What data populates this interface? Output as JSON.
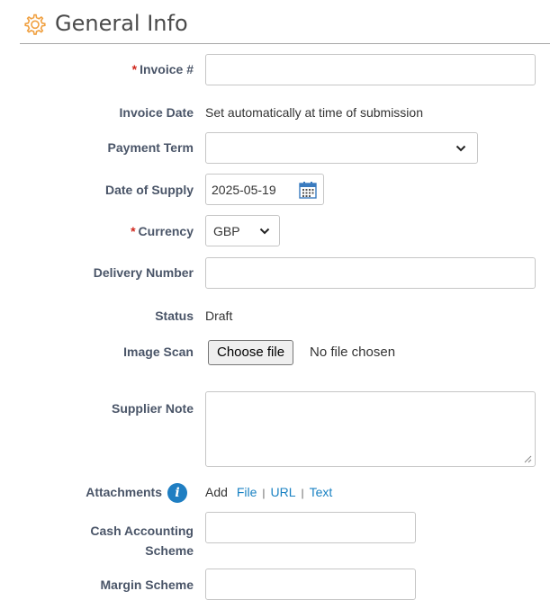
{
  "section": {
    "title": "General Info",
    "icon": "gear-icon"
  },
  "fields": {
    "invoice_number": {
      "label": "Invoice #",
      "required_marker": "*",
      "value": ""
    },
    "invoice_date": {
      "label": "Invoice Date",
      "value": "Set automatically at time of submission"
    },
    "payment_term": {
      "label": "Payment Term",
      "value": ""
    },
    "date_of_supply": {
      "label": "Date of Supply",
      "value": "2025-05-19"
    },
    "currency": {
      "label": "Currency",
      "required_marker": "*",
      "value": "GBP"
    },
    "delivery_number": {
      "label": "Delivery Number",
      "value": ""
    },
    "status": {
      "label": "Status",
      "value": "Draft"
    },
    "image_scan": {
      "label": "Image Scan",
      "button": "Choose file",
      "status": "No file chosen"
    },
    "supplier_note": {
      "label": "Supplier Note",
      "value": ""
    },
    "attachments": {
      "label": "Attachments",
      "add": "Add",
      "links": [
        "File",
        "URL",
        "Text"
      ],
      "separator": "|"
    },
    "cash_accounting": {
      "label_line1": "Cash Accounting",
      "label_line2": "Scheme",
      "value": ""
    },
    "margin_scheme": {
      "label": "Margin Scheme",
      "value": ""
    }
  },
  "colors": {
    "required": "#d0271d",
    "link": "#1a82c3",
    "label": "#4a5568",
    "gear": "#f0a040"
  }
}
